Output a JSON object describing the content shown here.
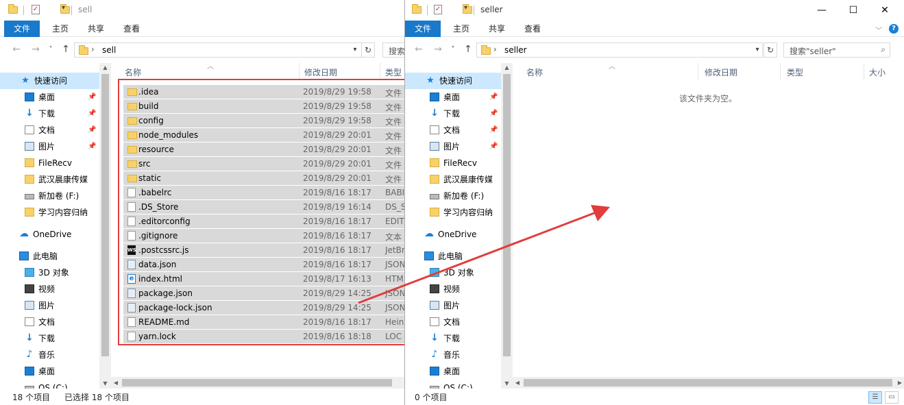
{
  "left_window": {
    "title": "sell",
    "ribbon_tabs": [
      "文件",
      "主页",
      "共享",
      "查看"
    ],
    "address": "sell",
    "search_placeholder": "搜索",
    "columns": [
      "名称",
      "修改日期",
      "类型"
    ],
    "files": [
      {
        "name": ".idea",
        "date": "2019/8/29 19:58",
        "type": "文件",
        "icon": "folder"
      },
      {
        "name": "build",
        "date": "2019/8/29 19:58",
        "type": "文件",
        "icon": "folder"
      },
      {
        "name": "config",
        "date": "2019/8/29 19:58",
        "type": "文件",
        "icon": "folder"
      },
      {
        "name": "node_modules",
        "date": "2019/8/29 20:01",
        "type": "文件",
        "icon": "folder"
      },
      {
        "name": "resource",
        "date": "2019/8/29 20:01",
        "type": "文件",
        "icon": "folder"
      },
      {
        "name": "src",
        "date": "2019/8/29 20:01",
        "type": "文件",
        "icon": "folder"
      },
      {
        "name": "static",
        "date": "2019/8/29 20:01",
        "type": "文件",
        "icon": "folder"
      },
      {
        "name": ".babelrc",
        "date": "2019/8/16 18:17",
        "type": "BABI",
        "icon": "file"
      },
      {
        "name": ".DS_Store",
        "date": "2019/8/19 16:14",
        "type": "DS_S",
        "icon": "file"
      },
      {
        "name": ".editorconfig",
        "date": "2019/8/16 18:17",
        "type": "EDIT",
        "icon": "file"
      },
      {
        "name": ".gitignore",
        "date": "2019/8/16 18:17",
        "type": "文本",
        "icon": "file"
      },
      {
        "name": ".postcssrc.js",
        "date": "2019/8/16 18:17",
        "type": "JetBr",
        "icon": "ws"
      },
      {
        "name": "data.json",
        "date": "2019/8/16 18:17",
        "type": "JSON",
        "icon": "json"
      },
      {
        "name": "index.html",
        "date": "2019/8/17 16:13",
        "type": "HTM",
        "icon": "ie"
      },
      {
        "name": "package.json",
        "date": "2019/8/29 14:25",
        "type": "JSON",
        "icon": "json"
      },
      {
        "name": "package-lock.json",
        "date": "2019/8/29 14:25",
        "type": "JSON",
        "icon": "json"
      },
      {
        "name": "README.md",
        "date": "2019/8/16 18:17",
        "type": "Hein",
        "icon": "file"
      },
      {
        "name": "yarn.lock",
        "date": "2019/8/16 18:18",
        "type": "LOC",
        "icon": "file"
      }
    ],
    "status_count": "18 个项目",
    "status_selected": "已选择 18 个项目"
  },
  "right_window": {
    "title": "seller",
    "ribbon_tabs": [
      "文件",
      "主页",
      "共享",
      "查看"
    ],
    "address": "seller",
    "search_placeholder": "搜索\"seller\"",
    "columns": [
      "名称",
      "修改日期",
      "类型",
      "大小"
    ],
    "empty_message": "该文件夹为空。",
    "status_count": "0 个项目"
  },
  "nav_items": [
    {
      "label": "快速访问",
      "icon": "star-icon",
      "pinned": false,
      "selected": true
    },
    {
      "label": "桌面",
      "icon": "desktop-icon",
      "pinned": true
    },
    {
      "label": "下载",
      "icon": "download-icon",
      "pinned": true
    },
    {
      "label": "文档",
      "icon": "document-icon",
      "pinned": true
    },
    {
      "label": "图片",
      "icon": "pictures-icon",
      "pinned": true
    },
    {
      "label": "FileRecv",
      "icon": "folder-icon",
      "pinned": false
    },
    {
      "label": "武汉晨康传媒",
      "icon": "folder-icon",
      "pinned": false
    },
    {
      "label": "新加卷 (F:)",
      "icon": "drive-icon",
      "pinned": false
    },
    {
      "label": "学习内容归纳",
      "icon": "folder-icon",
      "pinned": false
    },
    {
      "label": "OneDrive",
      "icon": "cloud-icon",
      "pinned": false
    },
    {
      "label": "此电脑",
      "icon": "pc-icon",
      "pinned": false
    },
    {
      "label": "3D 对象",
      "icon": "3d-objects-icon",
      "pinned": false
    },
    {
      "label": "视频",
      "icon": "video-icon",
      "pinned": false
    },
    {
      "label": "图片",
      "icon": "pictures-icon",
      "pinned": false
    },
    {
      "label": "文档",
      "icon": "document-icon",
      "pinned": false
    },
    {
      "label": "下载",
      "icon": "download-icon",
      "pinned": false
    },
    {
      "label": "音乐",
      "icon": "music-icon",
      "pinned": false
    },
    {
      "label": "桌面",
      "icon": "desktop-icon",
      "pinned": false
    },
    {
      "label": "OS (C:)",
      "icon": "drive-icon",
      "pinned": false
    }
  ],
  "window_controls": {
    "minimize": "—",
    "maximize": "☐",
    "close": "✕"
  },
  "colors": {
    "ribbon_file_tab": "#1979ca",
    "selection": "#cce8ff",
    "highlight_box": "#e23c3c",
    "arrow": "#e23c3c"
  }
}
